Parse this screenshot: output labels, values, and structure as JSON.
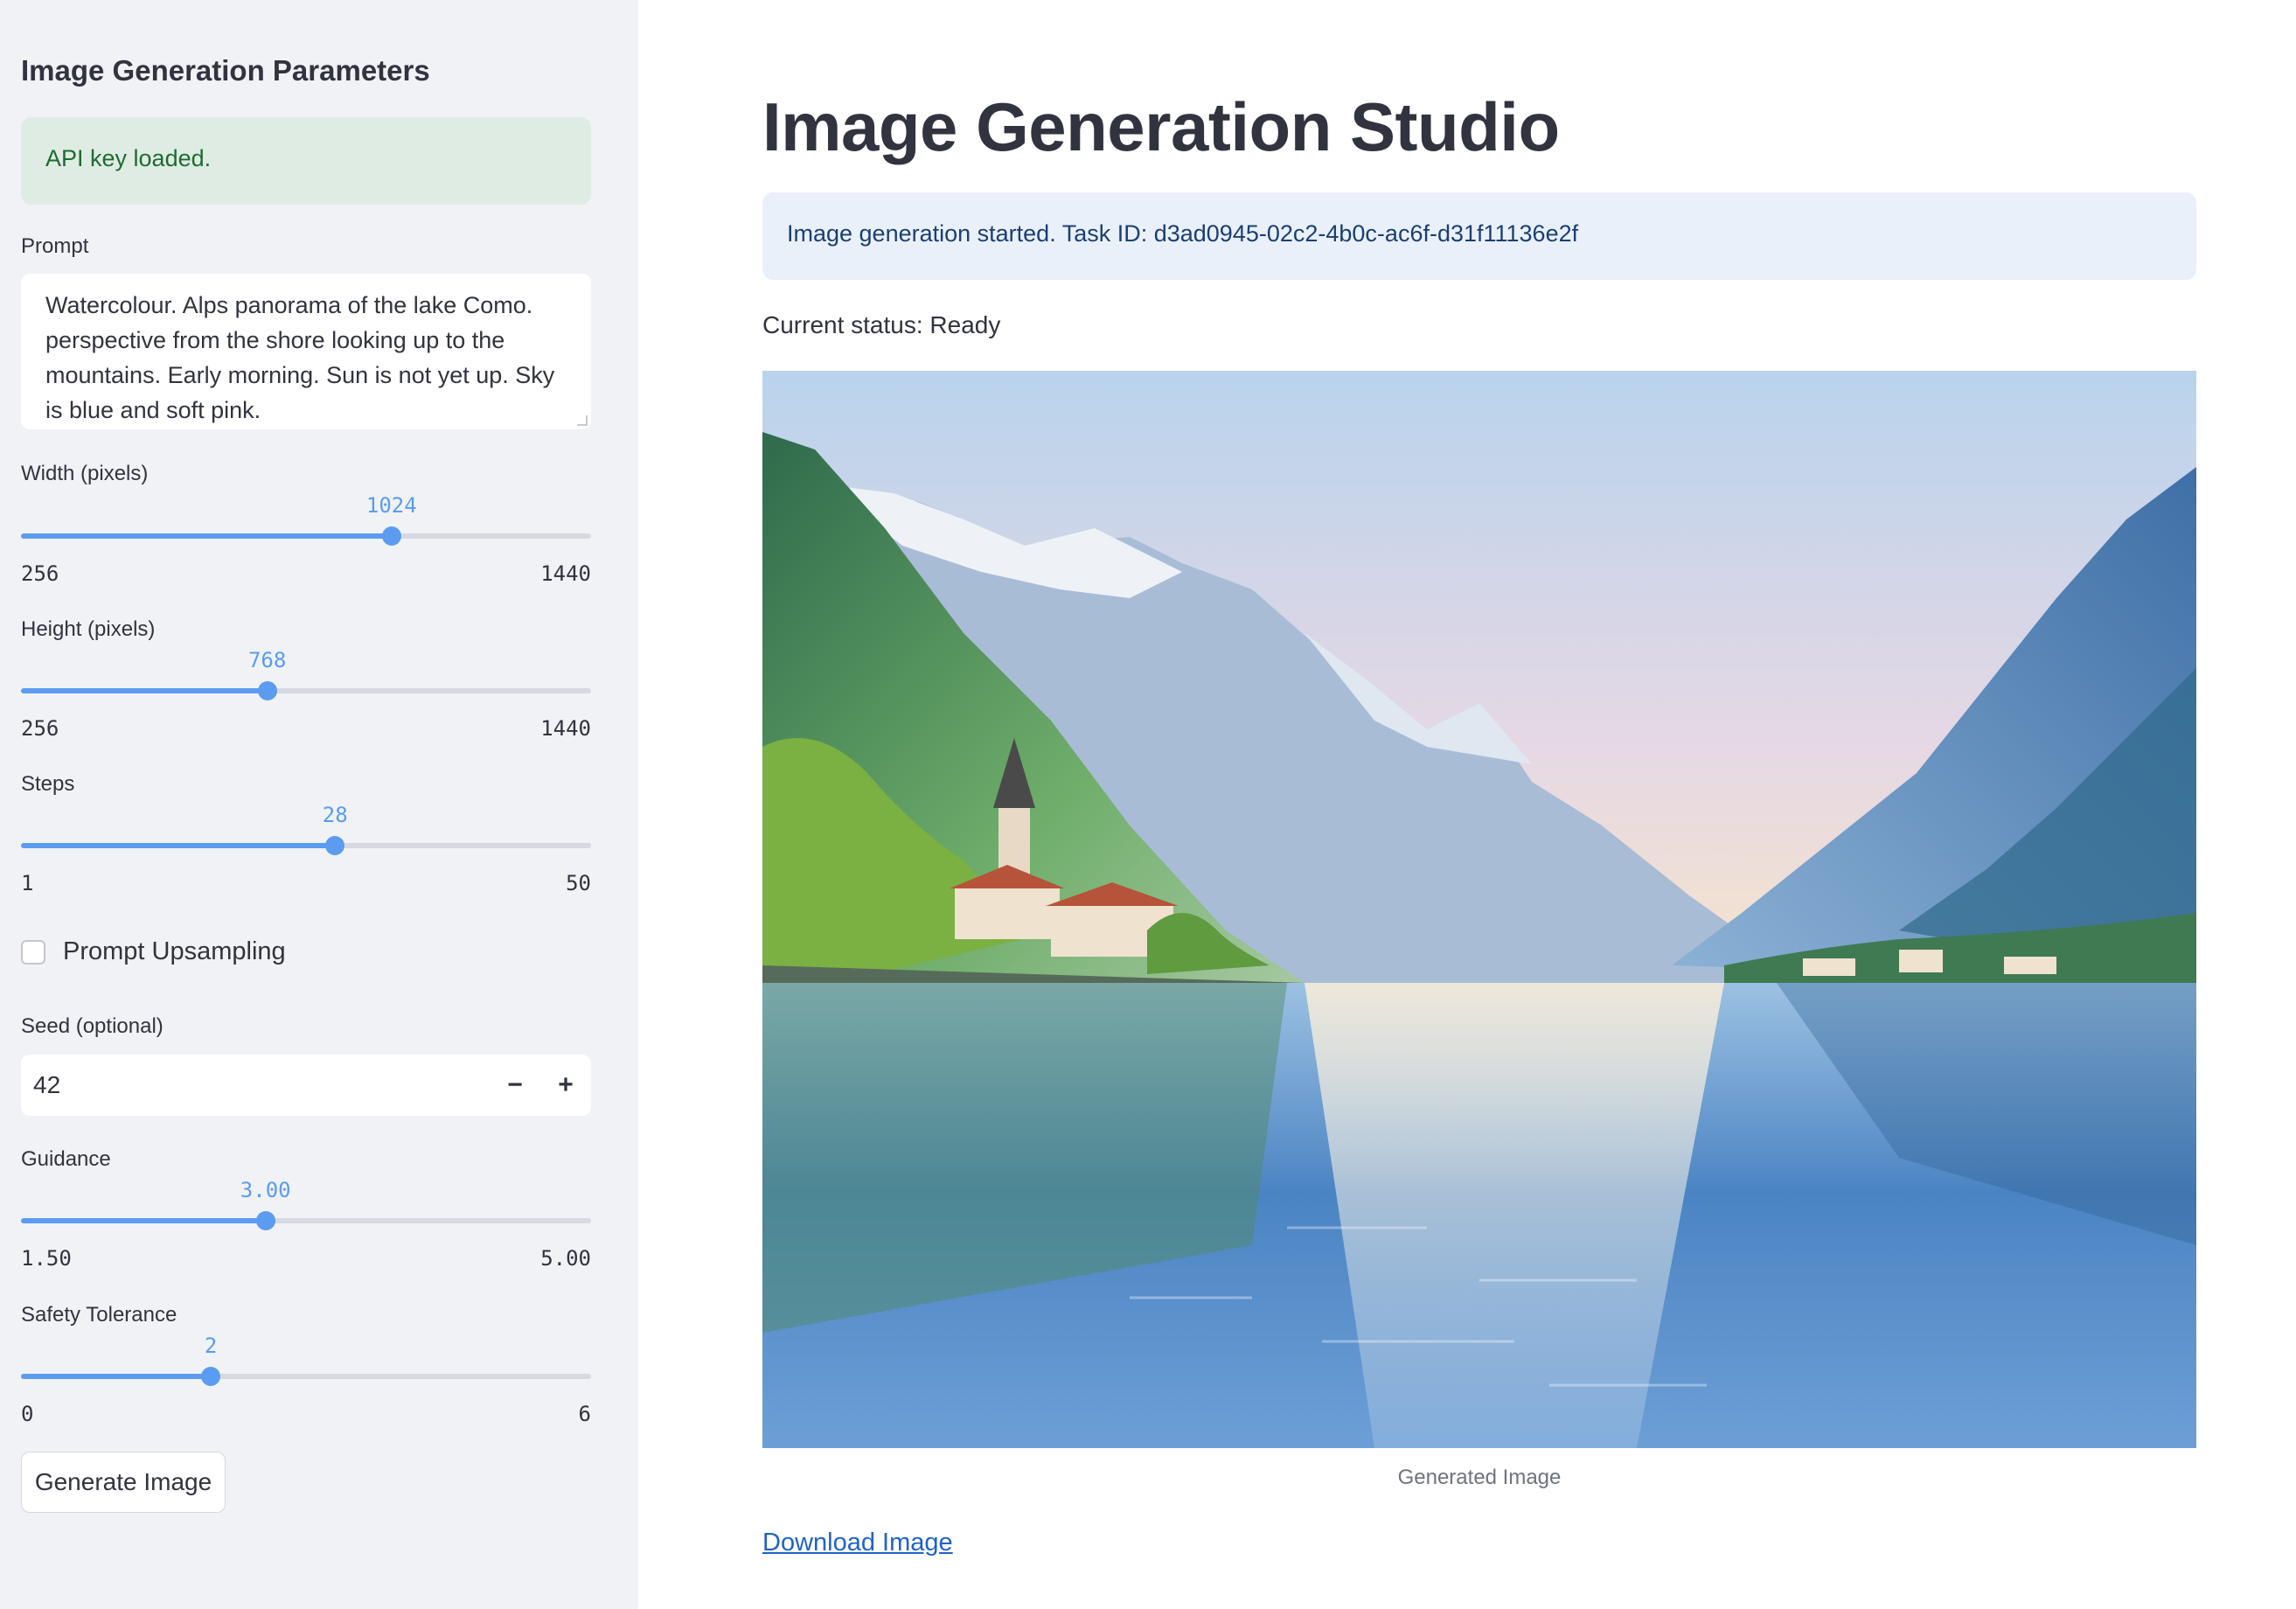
{
  "sidebar": {
    "title": "Image Generation Parameters",
    "api_status": "API key loaded.",
    "prompt": {
      "label": "Prompt",
      "value": "Watercolour. Alps panorama of the lake Como. perspective from the shore looking up to the mountains. Early morning. Sun is not yet up. Sky is blue and soft pink."
    },
    "width": {
      "label": "Width (pixels)",
      "value": "1024",
      "min": "256",
      "max": "1440",
      "fraction": 0.65
    },
    "height": {
      "label": "Height (pixels)",
      "value": "768",
      "min": "256",
      "max": "1440",
      "fraction": 0.432
    },
    "steps": {
      "label": "Steps",
      "value": "28",
      "min": "1",
      "max": "50",
      "fraction": 0.551
    },
    "prompt_upsampling": {
      "label": "Prompt Upsampling",
      "checked": false
    },
    "seed": {
      "label": "Seed (optional)",
      "value": "42",
      "minus": "−",
      "plus": "+"
    },
    "guidance": {
      "label": "Guidance",
      "value": "3.00",
      "min": "1.50",
      "max": "5.00",
      "fraction": 0.429
    },
    "safety": {
      "label": "Safety Tolerance",
      "value": "2",
      "min": "0",
      "max": "6",
      "fraction": 0.333
    },
    "generate_button": "Generate Image"
  },
  "main": {
    "title": "Image Generation Studio",
    "info": "Image generation started. Task ID: d3ad0945-02c2-4b0c-ac6f-d31f11136e2f",
    "status": "Current status: Ready",
    "image_caption": "Generated Image",
    "download_link": "Download Image"
  },
  "colors": {
    "accent": "#5b9cf0",
    "sidebar_bg": "#f0f2f6",
    "success_bg": "#dfece3",
    "info_bg": "#e9f0fa",
    "link": "#1f63c6"
  }
}
